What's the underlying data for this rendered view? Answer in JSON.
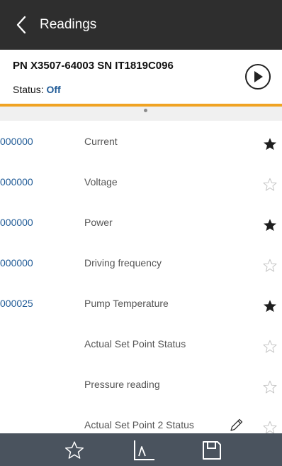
{
  "header": {
    "title": "Readings",
    "back_icon": "chevron-left-icon"
  },
  "device": {
    "pn_sn": "PN X3507-64003 SN IT1819C096",
    "status_label": "Status:",
    "status_value": "Off",
    "play_icon": "play-circle-icon"
  },
  "colors": {
    "accent": "#f0a323",
    "value_blue": "#1f5a96",
    "topbar": "#2e2e2e",
    "bottombar": "#4a535e"
  },
  "readings": [
    {
      "value": "000000",
      "label": "Current",
      "favorite": true
    },
    {
      "value": "000000",
      "label": "Voltage",
      "favorite": false
    },
    {
      "value": "000000",
      "label": "Power",
      "favorite": true
    },
    {
      "value": "000000",
      "label": "Driving frequency",
      "favorite": false
    },
    {
      "value": "000025",
      "label": "Pump Temperature",
      "favorite": true
    },
    {
      "value": "",
      "label": "Actual Set Point Status",
      "favorite": false
    },
    {
      "value": "",
      "label": "Pressure reading",
      "favorite": false
    },
    {
      "value": "",
      "label": "Actual Set Point 2 Status",
      "favorite": false,
      "editable": true
    }
  ],
  "bottom_bar": {
    "items": [
      {
        "icon": "star-outline-icon"
      },
      {
        "icon": "chart-icon"
      },
      {
        "icon": "save-icon"
      }
    ]
  }
}
